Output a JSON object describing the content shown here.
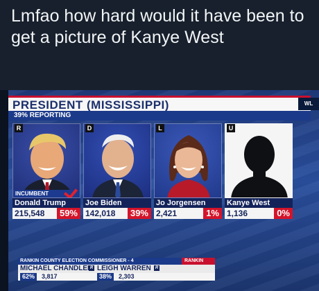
{
  "caption": "Lmfao how hard would it have been to get a picture of Kanye West",
  "broadcast": {
    "title": "PRESIDENT (MISSISSIPPI)",
    "reporting": "39% REPORTING",
    "corner_logo": "WL",
    "candidates": [
      {
        "party": "R",
        "name": "Donald Trump",
        "votes": "215,548",
        "pct": "59%",
        "incumbent": "INCUMBENT",
        "winner": true
      },
      {
        "party": "D",
        "name": "Joe Biden",
        "votes": "142,018",
        "pct": "39%"
      },
      {
        "party": "L",
        "name": "Jo Jorgensen",
        "votes": "2,421",
        "pct": "1%"
      },
      {
        "party": "U",
        "name": "Kanye West",
        "votes": "1,136",
        "pct": "0%"
      }
    ],
    "ticker": {
      "label": "RANKIN COUNTY ELECTION COMMISSIONER - 4",
      "region": "RANKIN",
      "cand1": {
        "name": "MICHAEL CHANDLER",
        "tag": "R",
        "pct": "62%",
        "votes": "3,817"
      },
      "cand2": {
        "name": "LEIGH WARREN",
        "tag": "R",
        "pct": "38%",
        "votes": "2,303"
      }
    }
  }
}
